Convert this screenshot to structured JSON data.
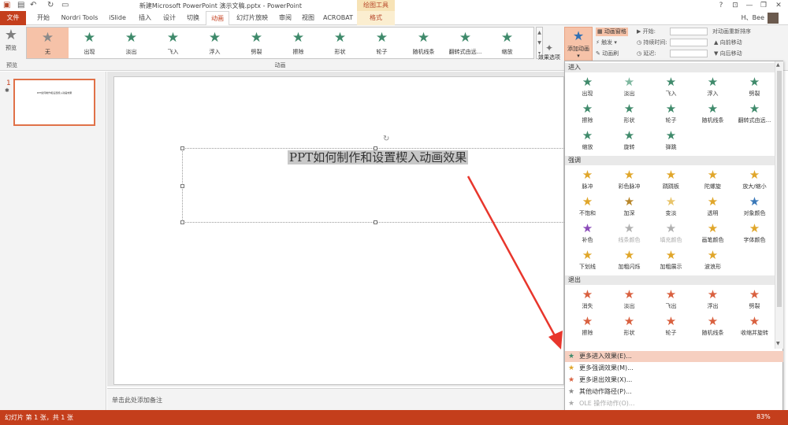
{
  "window": {
    "title": "新建Microsoft PowerPoint 演示文稿.pptx - PowerPoint",
    "context_tool": "绘图工具",
    "controls": [
      "?",
      "⊡",
      "—",
      "❐",
      "✕"
    ]
  },
  "tabs": [
    {
      "label": "文件"
    },
    {
      "label": "开始"
    },
    {
      "label": "Nordri Tools"
    },
    {
      "label": "iSlide"
    },
    {
      "label": "插入"
    },
    {
      "label": "设计"
    },
    {
      "label": "切换"
    },
    {
      "label": "动画"
    },
    {
      "label": "幻灯片放映"
    },
    {
      "label": "审阅"
    },
    {
      "label": "视图"
    },
    {
      "label": "ACROBAT"
    },
    {
      "label": "格式"
    }
  ],
  "user": {
    "name": "H、Bee"
  },
  "ribbon": {
    "preview_label": "预览",
    "preview_group": "预览",
    "animation_group": "动画",
    "gallery": [
      {
        "label": "无",
        "icon": "star-icon"
      },
      {
        "label": "出现",
        "icon": "star-icon"
      },
      {
        "label": "淡出",
        "icon": "star-icon"
      },
      {
        "label": "飞入",
        "icon": "star-icon"
      },
      {
        "label": "浮入",
        "icon": "star-icon"
      },
      {
        "label": "劈裂",
        "icon": "star-icon"
      },
      {
        "label": "擦除",
        "icon": "star-icon"
      },
      {
        "label": "形状",
        "icon": "star-icon"
      },
      {
        "label": "轮子",
        "icon": "star-icon"
      },
      {
        "label": "随机线条",
        "icon": "star-icon"
      },
      {
        "label": "翻转式由远...",
        "icon": "star-icon"
      },
      {
        "label": "缩放",
        "icon": "star-icon"
      }
    ],
    "effect_options": "效果选项",
    "add_animation": "添加动画",
    "animation_pane": "动画窗格",
    "trigger": "触发",
    "animation_painter": "动画刷",
    "start": "开始:",
    "duration": "持续时间:",
    "delay": "延迟:",
    "reorder_title": "对动画重新排序",
    "move_earlier": "向前移动",
    "move_later": "向后移动"
  },
  "slide_pane": {
    "slide_number": "1",
    "thumb_title": "PPT如何制作和设置楔入动画效果"
  },
  "slide": {
    "title": "PPT如何制作和设置楔入动画效果"
  },
  "notes": {
    "placeholder": "单击此处添加备注"
  },
  "panel": {
    "sections": [
      {
        "header": "进入",
        "items": [
          {
            "label": "出现",
            "color": "#3f8a6b"
          },
          {
            "label": "淡出",
            "color": "#7fb8a0"
          },
          {
            "label": "飞入",
            "color": "#3f8a6b"
          },
          {
            "label": "浮入",
            "color": "#3f8a6b"
          },
          {
            "label": "劈裂",
            "color": "#3f8a6b"
          },
          {
            "label": "擦除",
            "color": "#3f8a6b"
          },
          {
            "label": "形状",
            "color": "#3f8a6b"
          },
          {
            "label": "轮子",
            "color": "#3f8a6b"
          },
          {
            "label": "随机线条",
            "color": "#3f8a6b"
          },
          {
            "label": "翻转式由远...",
            "color": "#3f8a6b"
          },
          {
            "label": "缩放",
            "color": "#3f8a6b"
          },
          {
            "label": "旋转",
            "color": "#3f8a6b"
          },
          {
            "label": "弹跳",
            "color": "#3f8a6b"
          }
        ]
      },
      {
        "header": "强调",
        "items": [
          {
            "label": "脉冲",
            "color": "#e0a62a"
          },
          {
            "label": "彩色脉冲",
            "color": "#e0a62a"
          },
          {
            "label": "跷跷板",
            "color": "#e0a62a"
          },
          {
            "label": "陀螺旋",
            "color": "#e0a62a"
          },
          {
            "label": "放大/缩小",
            "color": "#e0a62a"
          },
          {
            "label": "不饱和",
            "color": "#e0a62a"
          },
          {
            "label": "加深",
            "color": "#b8862a"
          },
          {
            "label": "变淡",
            "color": "#e8c46a"
          },
          {
            "label": "透明",
            "color": "#e0a62a"
          },
          {
            "label": "对象颜色",
            "color": "#3a78b8"
          },
          {
            "label": "补色",
            "color": "#8a4ab8"
          },
          {
            "label": "线条颜色",
            "color": "#b0b0b0",
            "disabled": true
          },
          {
            "label": "填充颜色",
            "color": "#b0b0b0",
            "disabled": true
          },
          {
            "label": "画笔颜色",
            "color": "#e0a62a"
          },
          {
            "label": "字体颜色",
            "color": "#e0a62a"
          },
          {
            "label": "下划线",
            "color": "#e0a62a"
          },
          {
            "label": "加粗闪烁",
            "color": "#e0a62a"
          },
          {
            "label": "加粗展示",
            "color": "#e0a62a"
          },
          {
            "label": "波浪形",
            "color": "#e0a62a"
          }
        ]
      },
      {
        "header": "退出",
        "items": [
          {
            "label": "消失",
            "color": "#d9603f"
          },
          {
            "label": "淡出",
            "color": "#d9603f"
          },
          {
            "label": "飞出",
            "color": "#d9603f"
          },
          {
            "label": "浮出",
            "color": "#d9603f"
          },
          {
            "label": "劈裂",
            "color": "#d9603f"
          },
          {
            "label": "擦除",
            "color": "#d9603f"
          },
          {
            "label": "形状",
            "color": "#d9603f"
          },
          {
            "label": "轮子",
            "color": "#d9603f"
          },
          {
            "label": "随机线条",
            "color": "#d9603f"
          },
          {
            "label": "收缩并旋转",
            "color": "#d9603f"
          }
        ]
      }
    ],
    "more": [
      {
        "label": "更多进入效果(E)...",
        "color": "#3f8a6b",
        "highlight": true
      },
      {
        "label": "更多强调效果(M)...",
        "color": "#e0a62a"
      },
      {
        "label": "更多退出效果(X)...",
        "color": "#d9603f"
      },
      {
        "label": "其他动作路径(P)...",
        "color": "#888888"
      },
      {
        "label": "OLE 操作动作(O)...",
        "color": "#aaaaaa",
        "disabled": true
      }
    ]
  },
  "status": {
    "slide_info": "幻灯片 第 1 张，共 1 张",
    "zoom": "83%"
  },
  "colors": {
    "accent": "#c43e1c",
    "selected": "#f6c2a8",
    "arrow": "#e8362c"
  }
}
